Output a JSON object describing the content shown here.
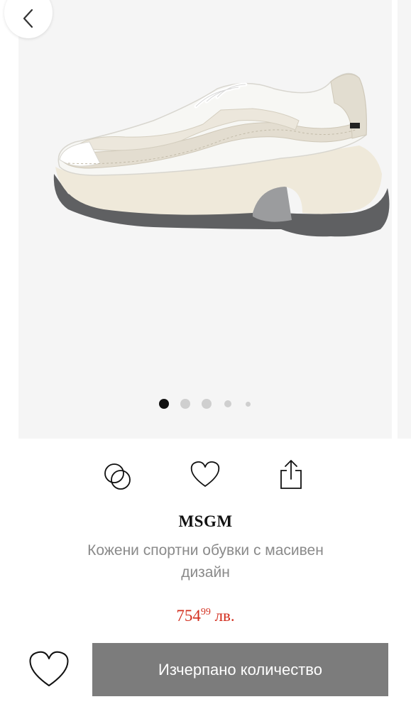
{
  "gallery": {
    "icons": {
      "back": "chevron-left-icon"
    },
    "image": "white-beige-chunky-sneaker",
    "pagination": {
      "count": 5,
      "active_index": 0
    }
  },
  "actions": {
    "icons": [
      "compare-icon",
      "heart-icon",
      "share-icon"
    ]
  },
  "product": {
    "brand": "MSGM",
    "title": "Кожени спортни обувки с масивен дизайн",
    "price": {
      "main": "754",
      "cents": "99",
      "currency": "лв.",
      "color": "#d32f1f"
    }
  },
  "footer": {
    "cta_label": "Изчерпано количество",
    "cta_color": "#7c7c7c",
    "wishlist_icon": "heart-icon"
  }
}
